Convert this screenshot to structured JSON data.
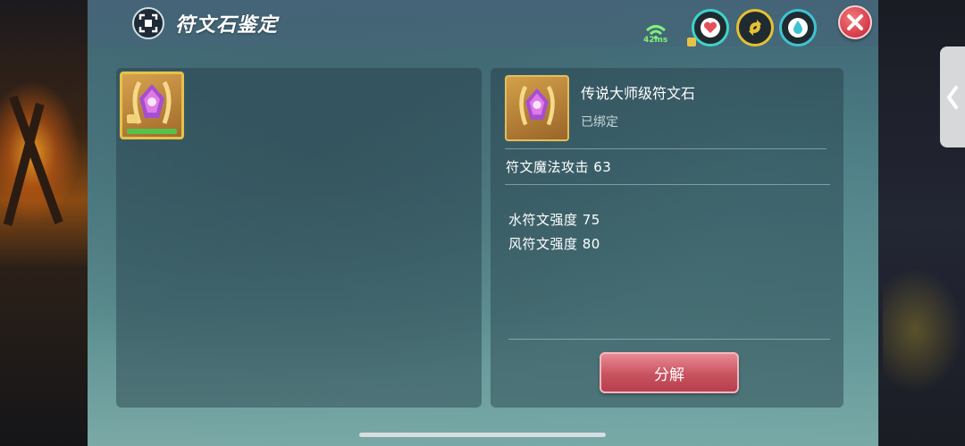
{
  "header": {
    "title": "符文石鉴定",
    "ping": "42ms",
    "stats": [
      {
        "name": "heart",
        "color": "#e4505a"
      },
      {
        "name": "swap",
        "color": "#e6c034"
      },
      {
        "name": "drop",
        "color": "#3ec3d0"
      }
    ]
  },
  "inventory": {
    "slots": [
      {
        "item": "传说大师级符文石",
        "selected": true
      }
    ]
  },
  "detail": {
    "name": "传说大师级符文石",
    "status": "已绑定",
    "main_attr": "符文魔法攻击 63",
    "sub_attrs": [
      "水符文强度 75",
      "风符文强度 80"
    ],
    "action_label": "分解"
  },
  "colors": {
    "accent_gold": "#e6c14a",
    "button_red": "#c9525f",
    "ping_green": "#7ff07a"
  }
}
